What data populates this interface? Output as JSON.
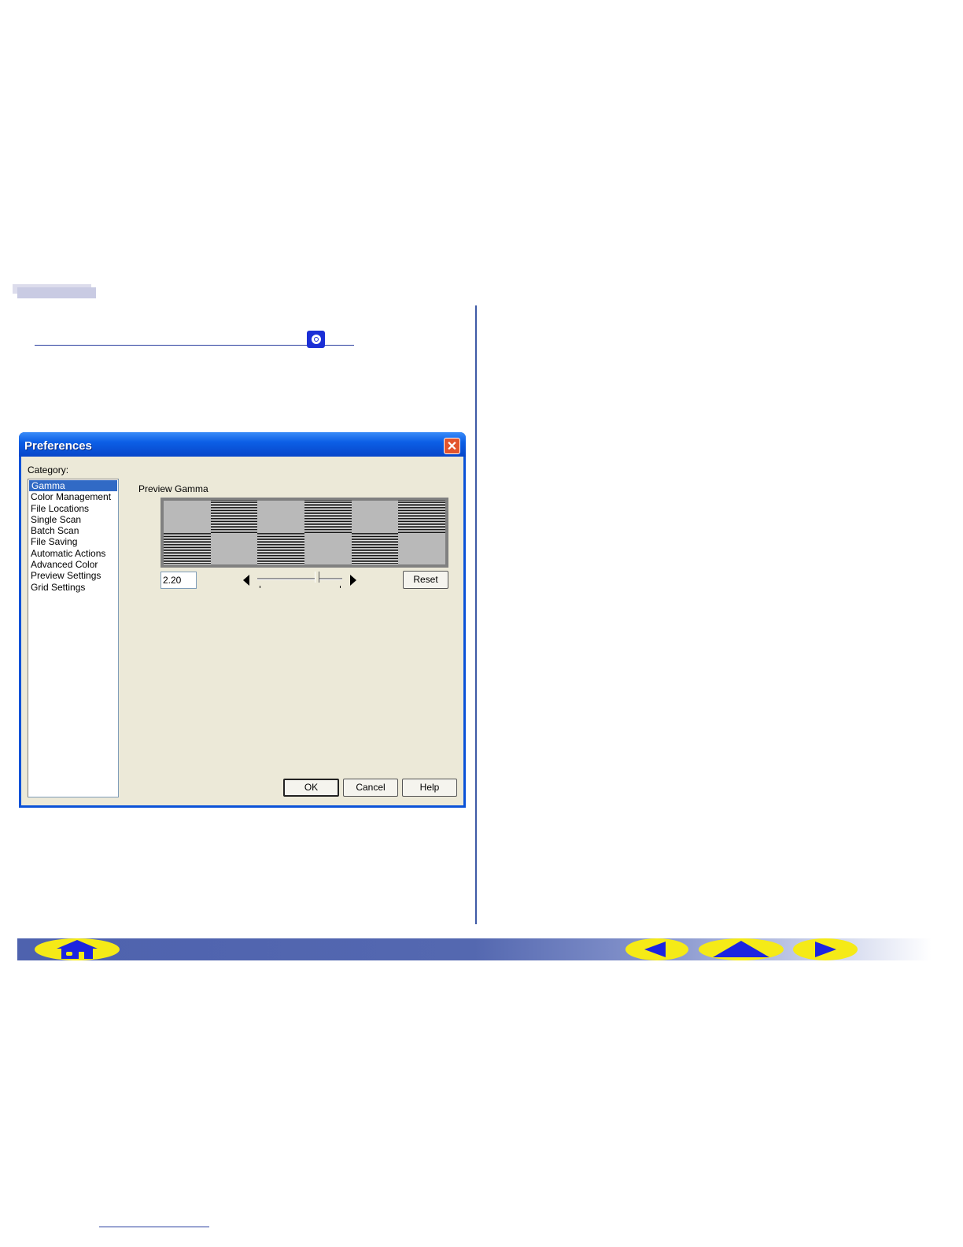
{
  "dialog": {
    "title": "Preferences",
    "close_glyph": "✕",
    "category_label": "Category:",
    "categories": [
      "Gamma",
      "Color Management",
      "File Locations",
      "Single Scan",
      "Batch Scan",
      "File Saving",
      "Automatic Actions",
      "Advanced Color",
      "Preview Settings",
      "Grid Settings"
    ],
    "selected_category": "Gamma",
    "preview_gamma_label": "Preview Gamma",
    "gamma_value": "2.20",
    "reset_label": "Reset",
    "ok_label": "OK",
    "cancel_label": "Cancel",
    "help_label": "Help"
  },
  "gamma_slider": {
    "level": 0.7
  },
  "icons": {
    "cd": "cd-rom-icon",
    "home": "home-icon",
    "prev": "previous-page-icon",
    "up": "up-page-icon",
    "next": "next-page-icon"
  },
  "colors": {
    "accent": "#3f5aa6",
    "nav_button": "#f5ea17",
    "nav_icon": "#1c24e0",
    "titlebar": "#0a52d8",
    "selection": "#316ac5"
  }
}
